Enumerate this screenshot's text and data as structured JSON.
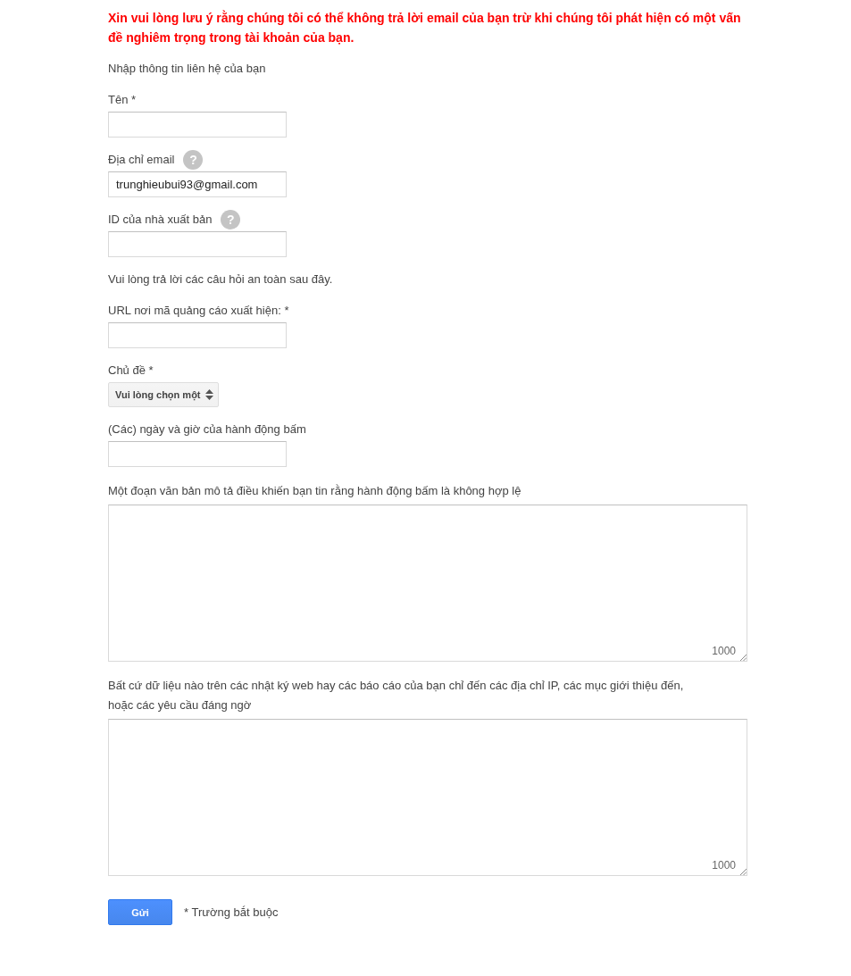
{
  "notice": "Xin vui lòng lưu ý rằng chúng tôi có thể không trả lời email của bạn trừ khi chúng tôi phát hiện có một vấn đề nghiêm trọng trong tài khoản của bạn.",
  "items": [
    {
      "kind": "text",
      "text": "Nhập thông tin liên hệ của bạn"
    },
    {
      "kind": "input",
      "label": "Tên *"
    },
    {
      "kind": "input",
      "label": "Địa chỉ email",
      "help": "?",
      "value": "trunghieubui93@gmail.com"
    },
    {
      "kind": "input",
      "label": "ID của nhà xuất bản",
      "help": "?"
    },
    {
      "kind": "text",
      "text": "Vui lòng trả lời các câu hỏi an toàn sau đây."
    },
    {
      "kind": "input",
      "label": "URL nơi mã quảng cáo xuất hiện: *"
    },
    {
      "kind": "select",
      "label": "Chủ đề *",
      "value": "Vui lòng chọn một"
    },
    {
      "kind": "input",
      "label": "(Các) ngày và giờ của hành động bấm"
    },
    {
      "kind": "textarea",
      "label": "Một đoạn văn bản mô tả điều khiến bạn tin rằng hành động bấm là không hợp lệ",
      "counter": "1000"
    },
    {
      "kind": "textarea",
      "label": "Bất cứ dữ liệu nào trên các nhật ký web hay các báo cáo của bạn chỉ đến các địa chỉ IP, các mục giới thiệu đến, hoặc các yêu cầu đáng ngờ",
      "counter": "1000"
    }
  ],
  "submit": "Gửi",
  "required_note": "* Trường bắt buộc"
}
